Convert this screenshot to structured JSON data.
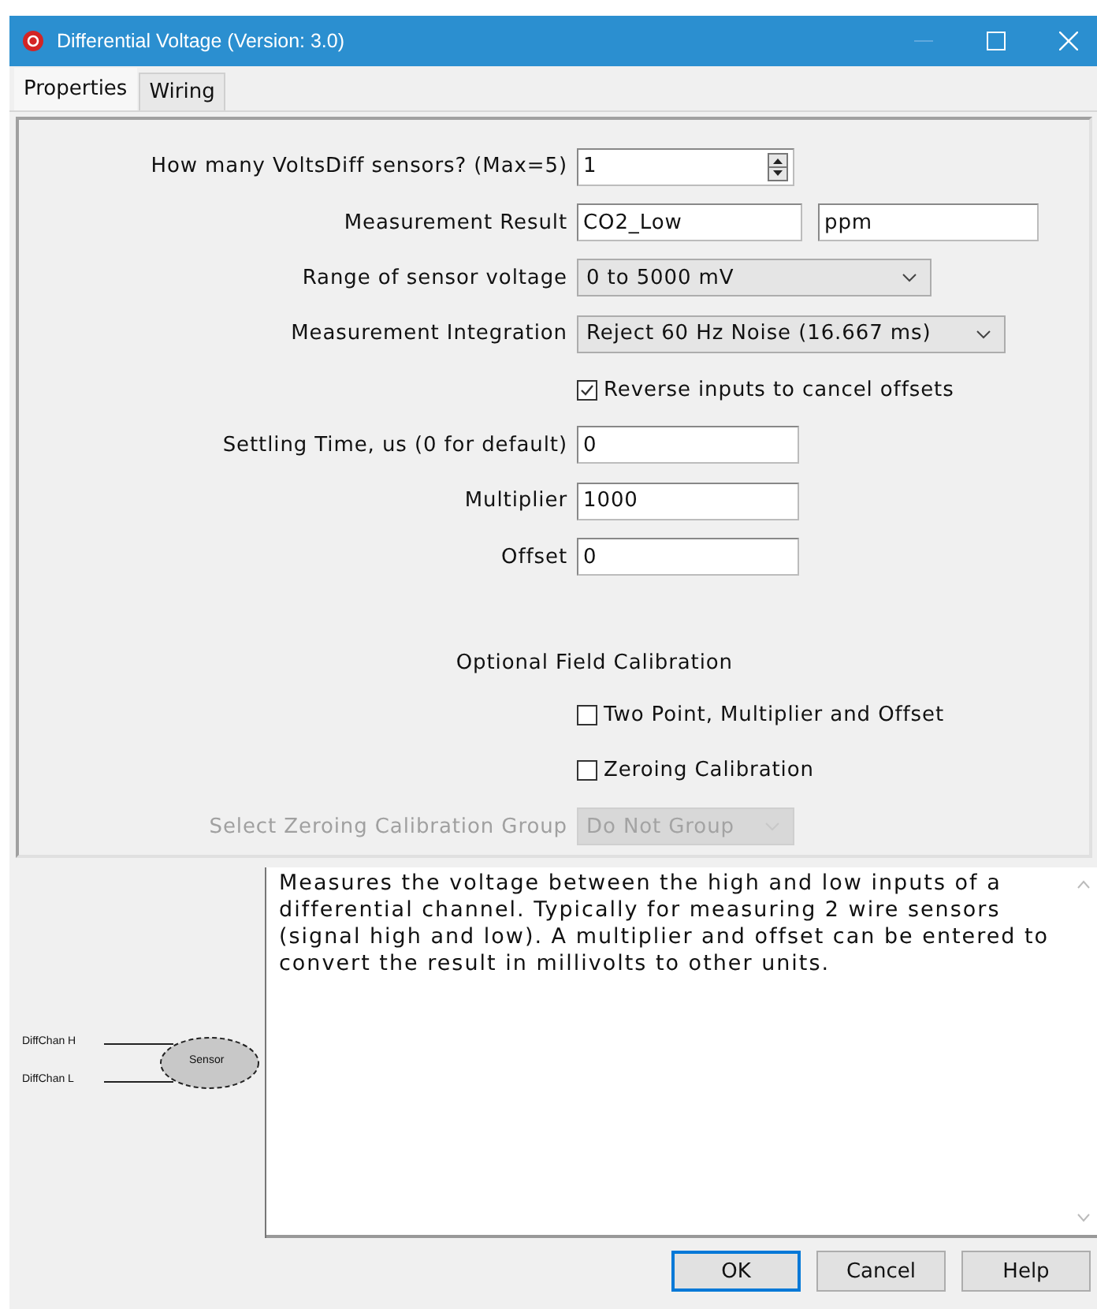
{
  "window": {
    "title": "Differential Voltage (Version: 3.0)"
  },
  "tabs": [
    {
      "label": "Properties",
      "selected": true
    },
    {
      "label": "Wiring",
      "selected": false
    }
  ],
  "form": [
    {
      "kind": "spinner",
      "label": "How many VoltsDiff sensors? (Max=5)",
      "value": "1"
    },
    {
      "kind": "text_pair",
      "label": "Measurement Result",
      "value": "CO2_Low",
      "value_2": "ppm"
    },
    {
      "kind": "dropdown",
      "label": "Range of sensor voltage",
      "value": "0 to 5000 mV",
      "disabled": false
    },
    {
      "kind": "dropdown",
      "label": "Measurement Integration",
      "value": "Reject 60 Hz Noise (16.667 ms)",
      "disabled": false
    },
    {
      "kind": "checkbox",
      "label": "Reverse inputs to cancel offsets",
      "checked": true
    },
    {
      "kind": "text",
      "label": "Settling Time, us (0 for default)",
      "value": "0"
    },
    {
      "kind": "text",
      "label": "Multiplier",
      "value": "1000"
    },
    {
      "kind": "text",
      "label": "Offset",
      "value": "0"
    },
    {
      "kind": "heading",
      "label": "Optional Field Calibration"
    },
    {
      "kind": "checkbox",
      "label": "Two Point, Multiplier and Offset",
      "checked": false
    },
    {
      "kind": "checkbox",
      "label": "Zeroing Calibration",
      "checked": false
    },
    {
      "kind": "dropdown",
      "label": "Select Zeroing Calibration Group",
      "value": "Do Not Group",
      "disabled": true
    }
  ],
  "diagram": {
    "terminals": [
      "DiffChan H",
      "DiffChan L"
    ],
    "device": "Sensor"
  },
  "description": "Measures the voltage between the high and low inputs of a differential channel. Typically for measuring 2 wire sensors (signal high and low). A multiplier and offset can be entered to convert the result in millivolts to other units.",
  "buttons": [
    "OK",
    "Cancel",
    "Help"
  ]
}
